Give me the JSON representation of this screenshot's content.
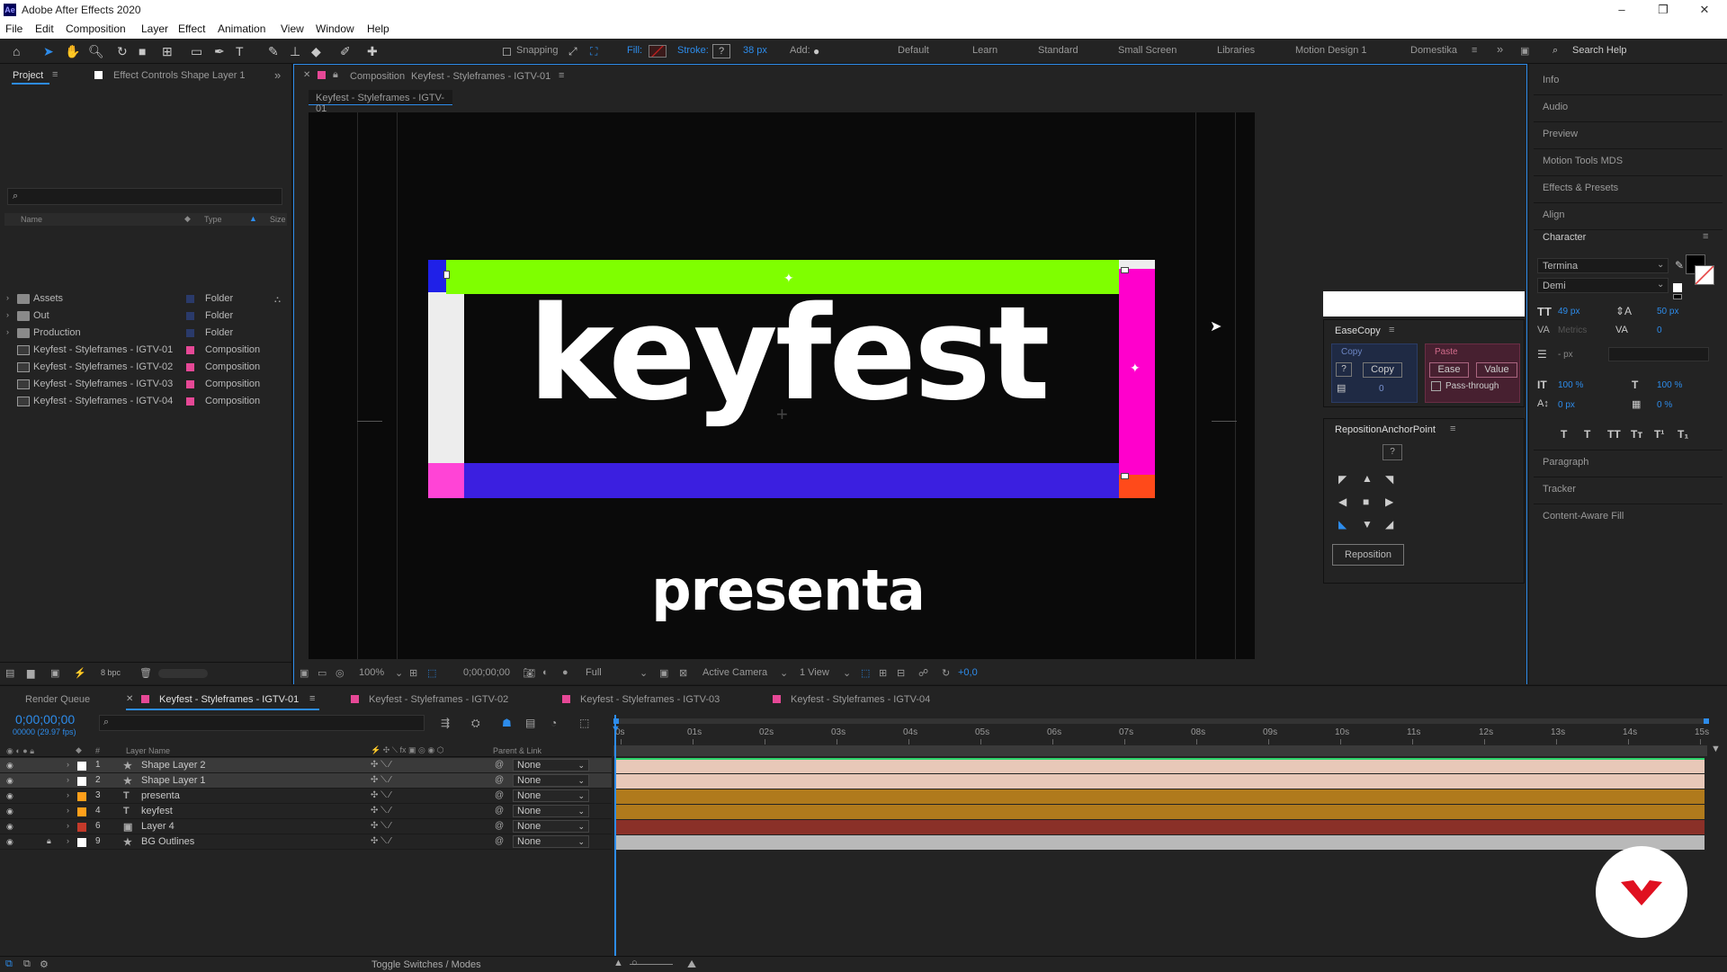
{
  "window": {
    "title": "Adobe After Effects 2020",
    "logo": "Ae",
    "minimize": "–",
    "maximize": "❐",
    "close": "✕"
  },
  "menu": [
    "File",
    "Edit",
    "Composition",
    "Layer",
    "Effect",
    "Animation",
    "View",
    "Window",
    "Help"
  ],
  "toolbar": {
    "snapping": "Snapping",
    "fill": "Fill:",
    "stroke": "Stroke:",
    "stroke_width": "38 px",
    "add": "Add:",
    "workspaces": [
      "Default",
      "Learn",
      "Standard",
      "Small Screen",
      "Libraries",
      "Motion Design 1",
      "Domestika"
    ],
    "search_help": "Search Help",
    "overflow": "»"
  },
  "project_panel": {
    "tab_project": "Project",
    "tab_effect_controls": "Effect Controls Shape Layer 1",
    "columns": {
      "name": "Name",
      "type": "Type",
      "size": "Size"
    },
    "items": [
      {
        "name": "Assets",
        "type": "Folder",
        "kind": "folder",
        "color": "#2a3a6a"
      },
      {
        "name": "Out",
        "type": "Folder",
        "kind": "folder",
        "color": "#2a3a6a"
      },
      {
        "name": "Production",
        "type": "Folder",
        "kind": "folder",
        "color": "#2a3a6a"
      },
      {
        "name": "Keyfest - Styleframes - IGTV-01",
        "type": "Composition",
        "kind": "comp",
        "color": "#e64896"
      },
      {
        "name": "Keyfest - Styleframes - IGTV-02",
        "type": "Composition",
        "kind": "comp",
        "color": "#e64896"
      },
      {
        "name": "Keyfest - Styleframes - IGTV-03",
        "type": "Composition",
        "kind": "comp",
        "color": "#e64896"
      },
      {
        "name": "Keyfest - Styleframes - IGTV-04",
        "type": "Composition",
        "kind": "comp",
        "color": "#e64896"
      }
    ],
    "bpc": "8 bpc"
  },
  "composition": {
    "tab_prefix": "Composition",
    "tab_name": "Keyfest - Styleframes - IGTV-01",
    "breadcrumb": "Keyfest - Styleframes - IGTV-01",
    "art": {
      "word1": "keyfest",
      "word2": "presenta"
    },
    "colors": {
      "green": "#7fff00",
      "magenta": "#ff00cc",
      "blue": "#3b1fe0",
      "pink": "#ff44d6",
      "white": "#ededed",
      "orange": "#ff4a1a",
      "dark_blue": "#1f20e8"
    },
    "footer": {
      "zoom": "100%",
      "timecode": "0;00;00;00",
      "resolution": "Full",
      "camera": "Active Camera",
      "views": "1 View",
      "exposure": "+0,0"
    }
  },
  "easecopy": {
    "title": "EaseCopy",
    "copy_label": "Copy",
    "copy_btn": "Copy",
    "question": "?",
    "count": "0",
    "paste_label": "Paste",
    "ease_btn": "Ease",
    "value_btn": "Value",
    "pass_through": "Pass-through"
  },
  "reposition": {
    "title": "RepositionAnchorPoint",
    "question": "?",
    "button": "Reposition"
  },
  "right_panel": {
    "items_top": [
      "Info",
      "Audio",
      "Preview",
      "Motion Tools MDS",
      "Effects & Presets",
      "Align"
    ],
    "character_title": "Character",
    "font": "Termina",
    "style": "Demi",
    "size": "49 px",
    "leading": "50 px",
    "kerning": "Metrics",
    "tracking": "0",
    "stroke_unit": "- px",
    "vscale": "100 %",
    "hscale": "100 %",
    "baseline": "0 px",
    "tsume": "0 %",
    "type_styles": [
      "T",
      "T",
      "TT",
      "Tт",
      "T¹",
      "T₁"
    ],
    "items_bottom": [
      "Paragraph",
      "Tracker",
      "Content-Aware Fill"
    ]
  },
  "timeline": {
    "tabs": [
      "Render Queue",
      "Keyfest - Styleframes - IGTV-01",
      "Keyfest - Styleframes - IGTV-02",
      "Keyfest - Styleframes - IGTV-03",
      "Keyfest - Styleframes - IGTV-04"
    ],
    "timecode": "0;00;00;00",
    "frame_info": "00000 (29.97 fps)",
    "col_hash": "#",
    "col_layer_name": "Layer Name",
    "col_parent": "Parent & Link",
    "ruler": [
      "0s",
      "01s",
      "02s",
      "03s",
      "04s",
      "05s",
      "06s",
      "07s",
      "08s",
      "09s",
      "10s",
      "11s",
      "12s",
      "13s",
      "14s",
      "15s"
    ],
    "layers": [
      {
        "num": "1",
        "type": "★",
        "name": "Shape Layer 2",
        "label": "#ffffff",
        "parent": "None",
        "selected": true,
        "bar": "#e8c8b8"
      },
      {
        "num": "2",
        "type": "★",
        "name": "Shape Layer 1",
        "label": "#ffffff",
        "parent": "None",
        "selected": true,
        "bar": "#e8c8b8"
      },
      {
        "num": "3",
        "type": "T",
        "name": "presenta",
        "label": "#ff9f1a",
        "parent": "None",
        "selected": false,
        "bar": "#b07a1c"
      },
      {
        "num": "4",
        "type": "T",
        "name": "keyfest",
        "label": "#ff9f1a",
        "parent": "None",
        "selected": false,
        "bar": "#b07a1c"
      },
      {
        "num": "6",
        "type": "▣",
        "name": "Layer 4",
        "label": "#c43a2a",
        "parent": "None",
        "selected": false,
        "bar": "#8a3028"
      },
      {
        "num": "9",
        "type": "★",
        "name": "BG Outlines",
        "label": "#ffffff",
        "parent": "None",
        "selected": false,
        "bar": "#b9b9b9"
      }
    ],
    "toggle": "Toggle Switches / Modes"
  }
}
